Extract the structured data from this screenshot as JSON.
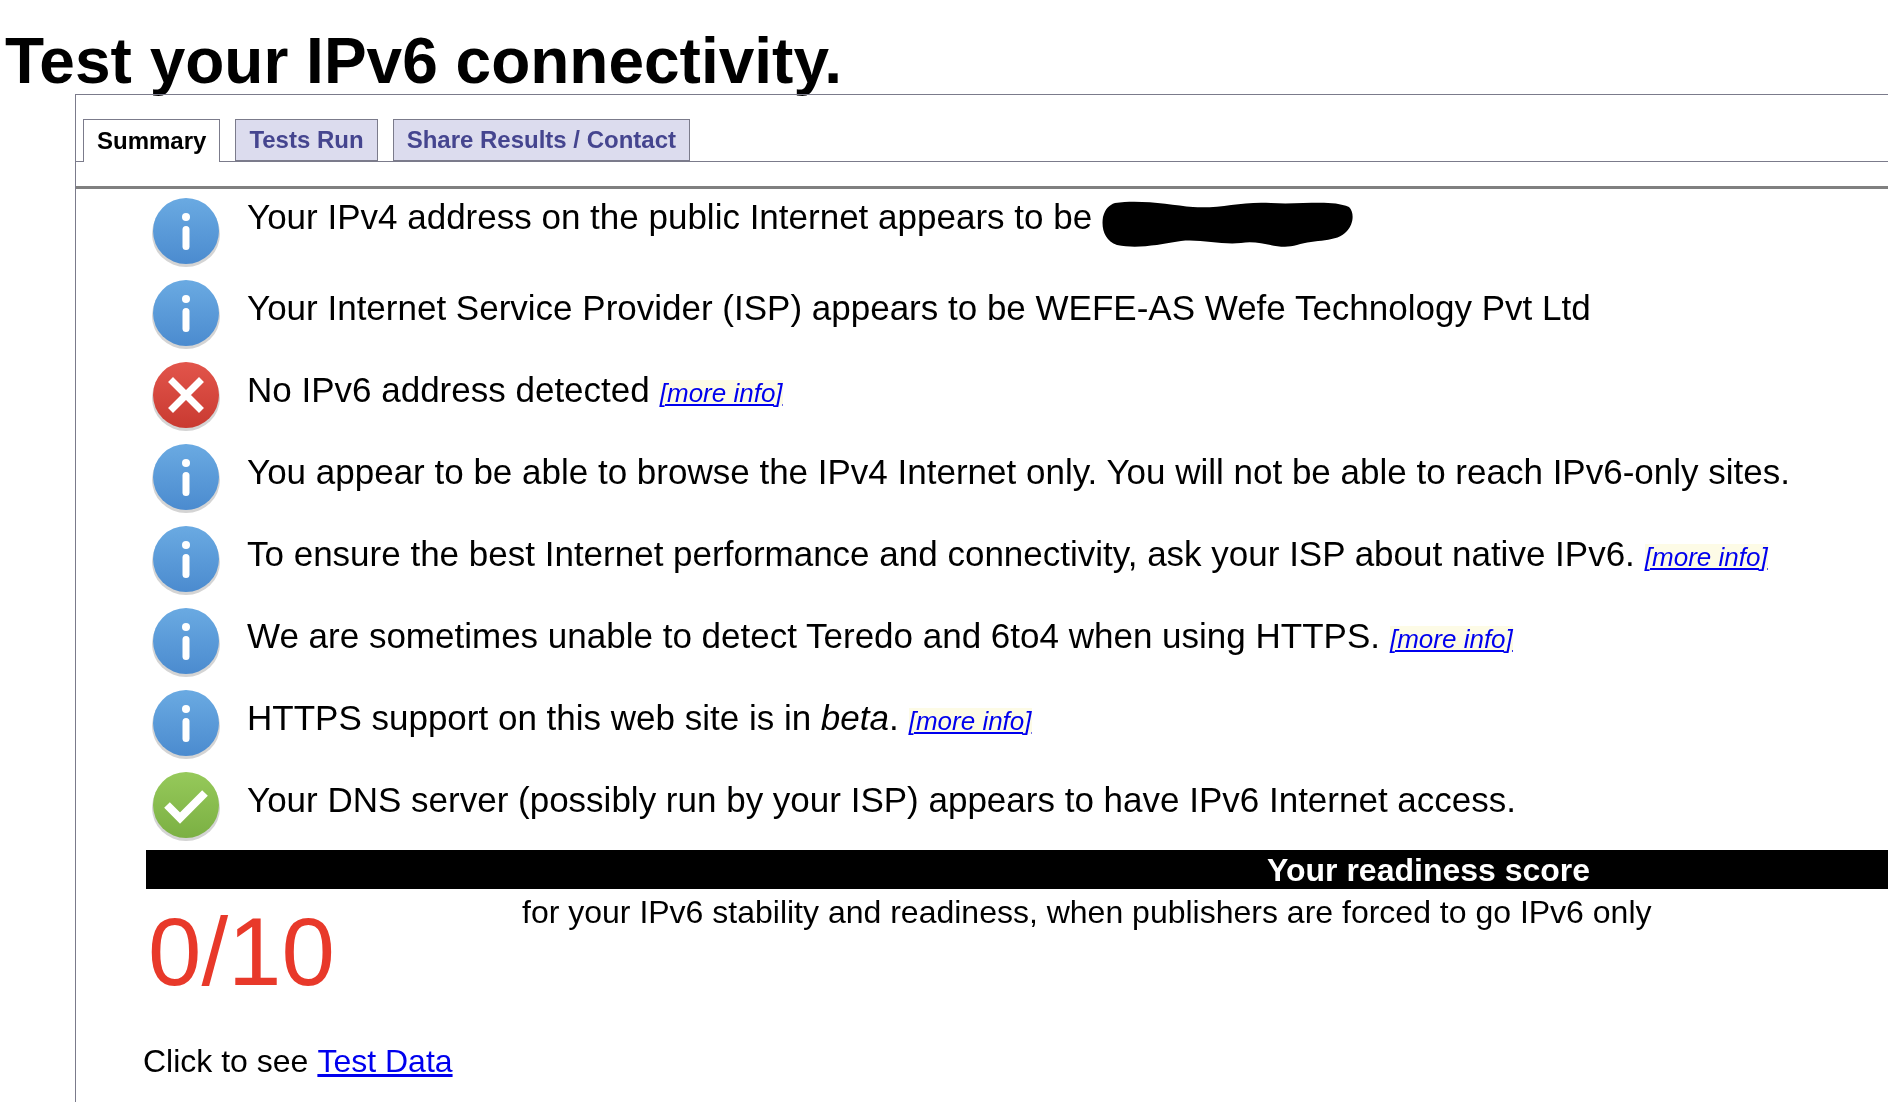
{
  "page": {
    "title": "Test your IPv6 connectivity."
  },
  "tabs": [
    {
      "label": "Summary",
      "selected": true
    },
    {
      "label": "Tests Run",
      "selected": false
    },
    {
      "label": "Share Results / Contact",
      "selected": false
    }
  ],
  "results": [
    {
      "kind": "info",
      "text": "Your IPv4 address on the public Internet appears to be",
      "redacted": true
    },
    {
      "kind": "info",
      "text": "Your Internet Service Provider (ISP) appears to be WEFE-AS Wefe Technology Pvt Ltd",
      "redacted": false
    },
    {
      "kind": "error",
      "text": "No IPv6 address detected",
      "link": "[more info]",
      "redacted": false
    },
    {
      "kind": "info",
      "text": "You appear to be able to browse the IPv4 Internet only. You will not be able to reach IPv6-only sites.",
      "redacted": false
    },
    {
      "kind": "info",
      "text": "To ensure the best Internet performance and connectivity, ask your ISP about native IPv6.",
      "link": "[more info]",
      "redacted": false
    },
    {
      "kind": "info",
      "text": "We are sometimes unable to detect Teredo and 6to4 when using HTTPS.",
      "link": "[more info]",
      "redacted": false
    },
    {
      "kind": "info",
      "text": "HTTPS support on this web site is in *beta*.",
      "link": "[more info]",
      "redacted": false
    },
    {
      "kind": "ok",
      "text": "Your DNS server (possibly run by your ISP) appears to have IPv6 Internet access.",
      "redacted": false
    }
  ],
  "readiness": {
    "heading": "Your readiness score",
    "score": "0/10",
    "description": "for your IPv6 stability and readiness, when publishers are forced to go IPv6 only"
  },
  "footer": {
    "text": "Click to see",
    "link": "Test Data"
  }
}
